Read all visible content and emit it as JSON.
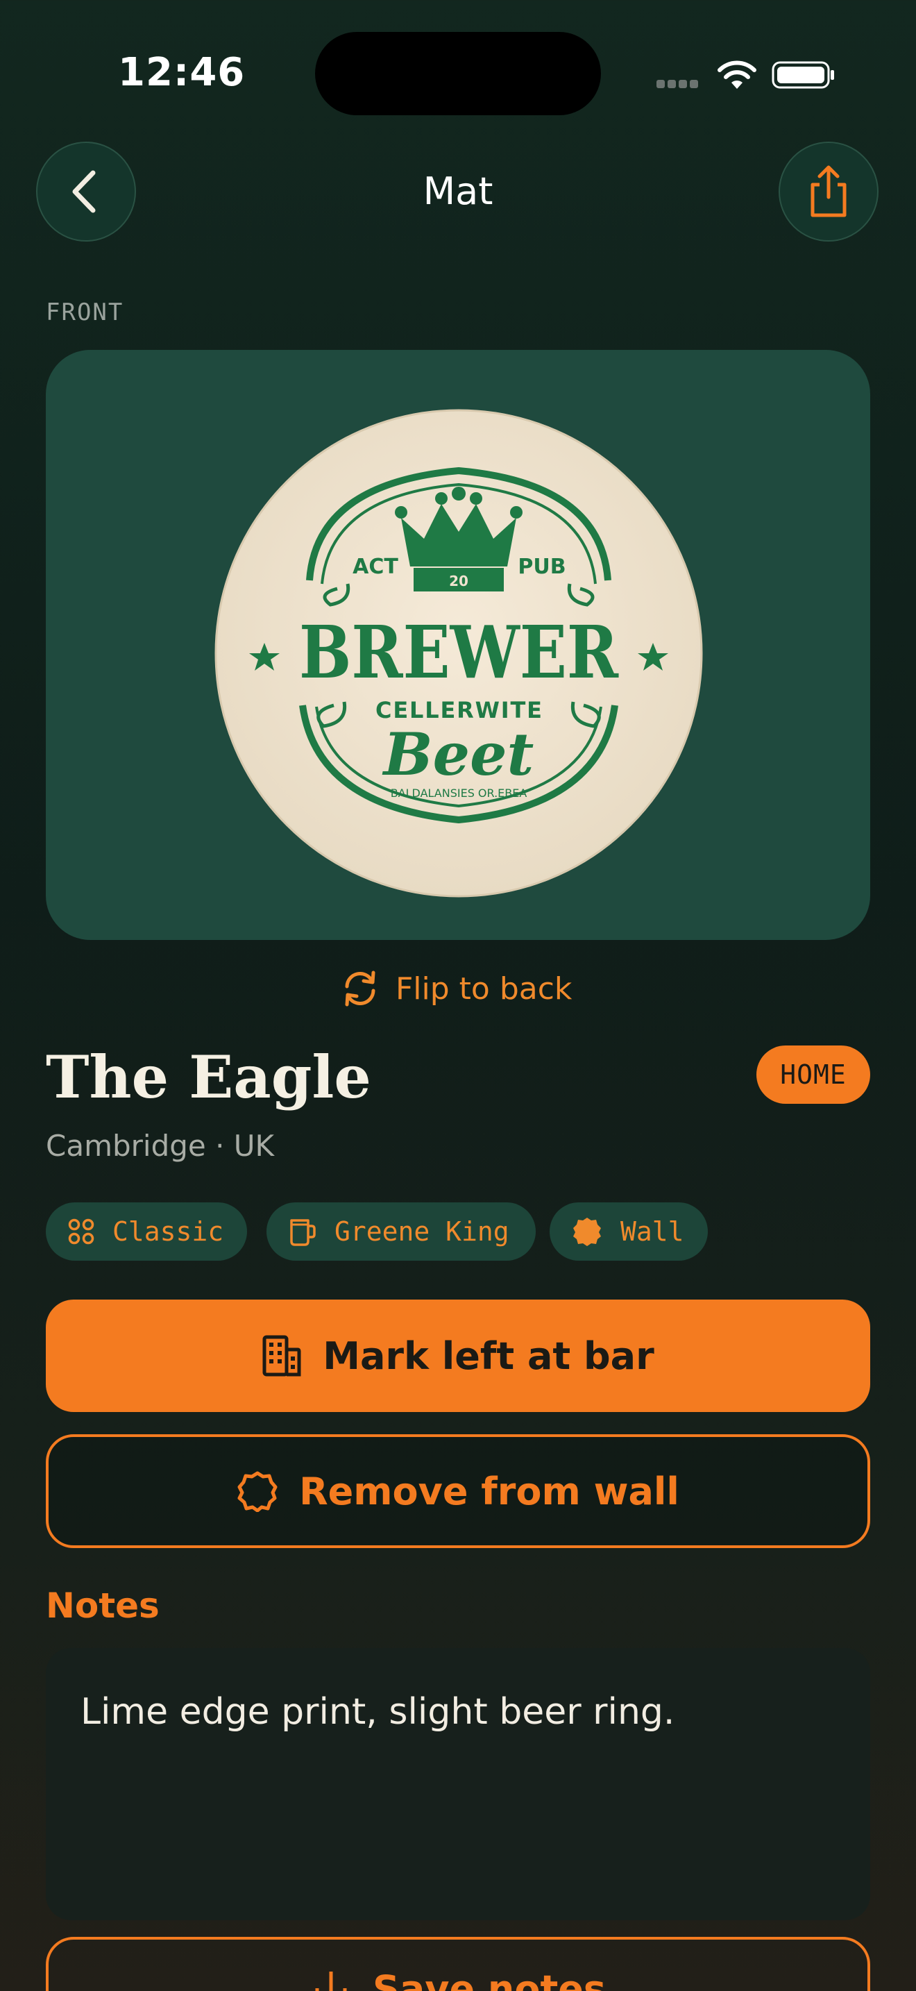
{
  "status_bar": {
    "time": "12:46"
  },
  "header": {
    "title": "Mat",
    "back_icon": "chevron-left-icon",
    "share_icon": "share-icon"
  },
  "image": {
    "side_label": "FRONT",
    "coaster_text": {
      "left_tag": "ACT",
      "right_tag": "PUB",
      "crown_num": "20",
      "brand": "BREWER",
      "sub": "CELLERWITE",
      "script": "Beet",
      "small": "BALDALANSIES OR.EBEA"
    }
  },
  "flip": {
    "label": "Flip to back",
    "icon": "refresh-icon"
  },
  "venue": {
    "name": "The Eagle",
    "badge": "HOME",
    "location": "Cambridge · UK"
  },
  "chips": [
    {
      "label": "Classic",
      "icon": "grid-icon"
    },
    {
      "label": "Greene King",
      "icon": "mug-icon"
    },
    {
      "label": "Wall",
      "icon": "badge-icon"
    }
  ],
  "actions": {
    "primary": {
      "label": "Mark left at bar",
      "icon": "building-icon"
    },
    "secondary": {
      "label": "Remove from wall",
      "icon": "badge-outline-icon"
    }
  },
  "notes": {
    "heading": "Notes",
    "text": "Lime edge print, slight beer ring.",
    "save_label": "Save notes"
  },
  "colors": {
    "accent": "#f47b20",
    "card": "#1f4a3e",
    "background": "#12271f",
    "coaster_ink": "#1f7a45"
  }
}
